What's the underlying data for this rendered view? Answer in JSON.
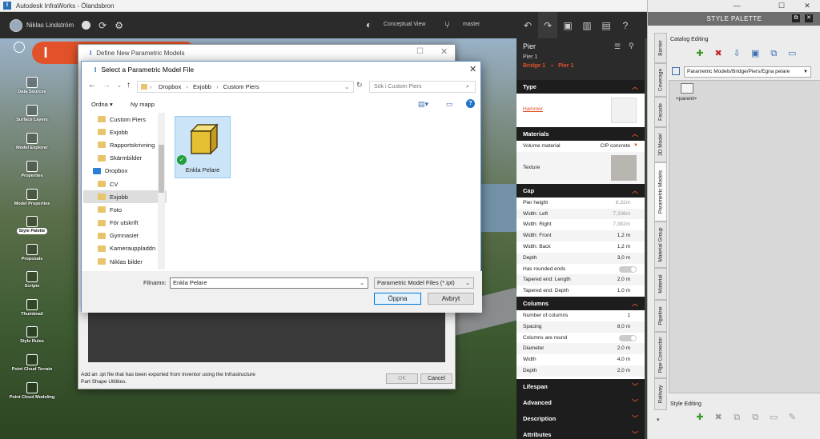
{
  "window": {
    "title": "Autodesk InfraWorks - Ölandsbron",
    "app_logo": "I"
  },
  "topbar": {
    "user": "Niklas Lindström",
    "view_mode": "Conceptual View",
    "branch": "master"
  },
  "left_tools": [
    {
      "label": "Data Sources"
    },
    {
      "label": "Surface Layers"
    },
    {
      "label": "Model Explorer"
    },
    {
      "label": "Properties"
    },
    {
      "label": "Model Properties"
    },
    {
      "label": "Style Palette",
      "selected": true
    },
    {
      "label": "Proposals"
    },
    {
      "label": "Scripts"
    },
    {
      "label": "Thumbnail"
    },
    {
      "label": "Style Rules"
    },
    {
      "label": "Point Cloud Terrain"
    },
    {
      "label": "Point Cloud Modeling"
    }
  ],
  "ribbon": {
    "logo": "I"
  },
  "define_dialog": {
    "title": "Define New Parametric Models",
    "help_text": "Add an .ipt file that has been exported from Inventor using the Infrastructure Part Shape Utilities.",
    "ok_label": "OK",
    "cancel_label": "Cancel"
  },
  "select_dialog": {
    "title": "Select a Parametric Model File",
    "breadcrumb": [
      "Dropbox",
      "Exjobb",
      "Custom Piers"
    ],
    "search_placeholder": "Sök i Custom Piers",
    "organize_label": "Ordna",
    "new_folder_label": "Ny mapp",
    "tree": [
      {
        "label": "Custom Piers",
        "indent": 1
      },
      {
        "label": "Exjobb",
        "indent": 1
      },
      {
        "label": "Rapportskrivning",
        "indent": 1
      },
      {
        "label": "Skärmbilder",
        "indent": 1
      },
      {
        "label": "Dropbox",
        "indent": 0,
        "root": true
      },
      {
        "label": "CV",
        "indent": 1
      },
      {
        "label": "Exjobb",
        "indent": 1,
        "selected": true
      },
      {
        "label": "Foto",
        "indent": 1
      },
      {
        "label": "För utskrift",
        "indent": 1
      },
      {
        "label": "Gymnasiet",
        "indent": 1
      },
      {
        "label": "Kamerauppladdn",
        "indent": 1
      },
      {
        "label": "Niklas bilder",
        "indent": 1
      }
    ],
    "file": {
      "name": "Enkla Pelare"
    },
    "filename_label": "Filnamn:",
    "filename_value": "Enkla Pelare",
    "filetype": "Parametric Model Files (*.ipt)",
    "open_label": "Öppna",
    "cancel_label": "Avbryt"
  },
  "properties": {
    "title": "Pier",
    "subtitle": "Pier 1",
    "crumbs": [
      "Bridge 1",
      "Pier 1"
    ],
    "type_section": "Type",
    "type_value": "Hammer",
    "materials_section": "Materials",
    "volume_material_label": "Volume material",
    "volume_material_value": "CIP concrete",
    "texture_label": "Texture",
    "cap_section": "Cap",
    "cap_rows": [
      {
        "label": "Pier height",
        "value": "8,32m",
        "muted": true
      },
      {
        "label": "Width: Left",
        "value": "7,336m",
        "muted": true
      },
      {
        "label": "Width: Right",
        "value": "7,382m",
        "muted": true
      },
      {
        "label": "Width: Front",
        "value": "1,2 m"
      },
      {
        "label": "Width: Back",
        "value": "1,2 m"
      },
      {
        "label": "Depth",
        "value": "3,0 m"
      },
      {
        "label": "Has rounded ends",
        "value": "",
        "toggle": true
      },
      {
        "label": "Tapered end: Length",
        "value": "2,0 m"
      },
      {
        "label": "Tapered end: Depth",
        "value": "1,0 m"
      }
    ],
    "columns_section": "Columns",
    "columns_rows": [
      {
        "label": "Number of columns",
        "value": "1"
      },
      {
        "label": "Spacing",
        "value": "8,0 m"
      },
      {
        "label": "Columns are round",
        "value": "",
        "toggle": true
      },
      {
        "label": "Diameter",
        "value": "2,0 m"
      },
      {
        "label": "Width",
        "value": "4,0 m"
      },
      {
        "label": "Depth",
        "value": "2,0 m"
      }
    ],
    "collapsed_sections": [
      "Lifespan",
      "Advanced",
      "Description",
      "Attributes"
    ]
  },
  "palette": {
    "title": "STYLE PALETTE",
    "catalog_editing": "Catalog Editing",
    "path": "Parametric Models/Bridge/Piers/Egna pelare",
    "parent_label": "<parent>",
    "style_editing": "Style Editing",
    "tabs": [
      "Barrier",
      "Coverage",
      "Facade",
      "3D Model",
      "Parametric Models",
      "Material Group",
      "Material",
      "Pipeline",
      "Pipe Connector",
      "Railway"
    ],
    "selected_tab": "Parametric Models"
  },
  "colors": {
    "accent": "#e2522a",
    "select_blue": "#0078d7",
    "dark": "#2b2b2b"
  }
}
